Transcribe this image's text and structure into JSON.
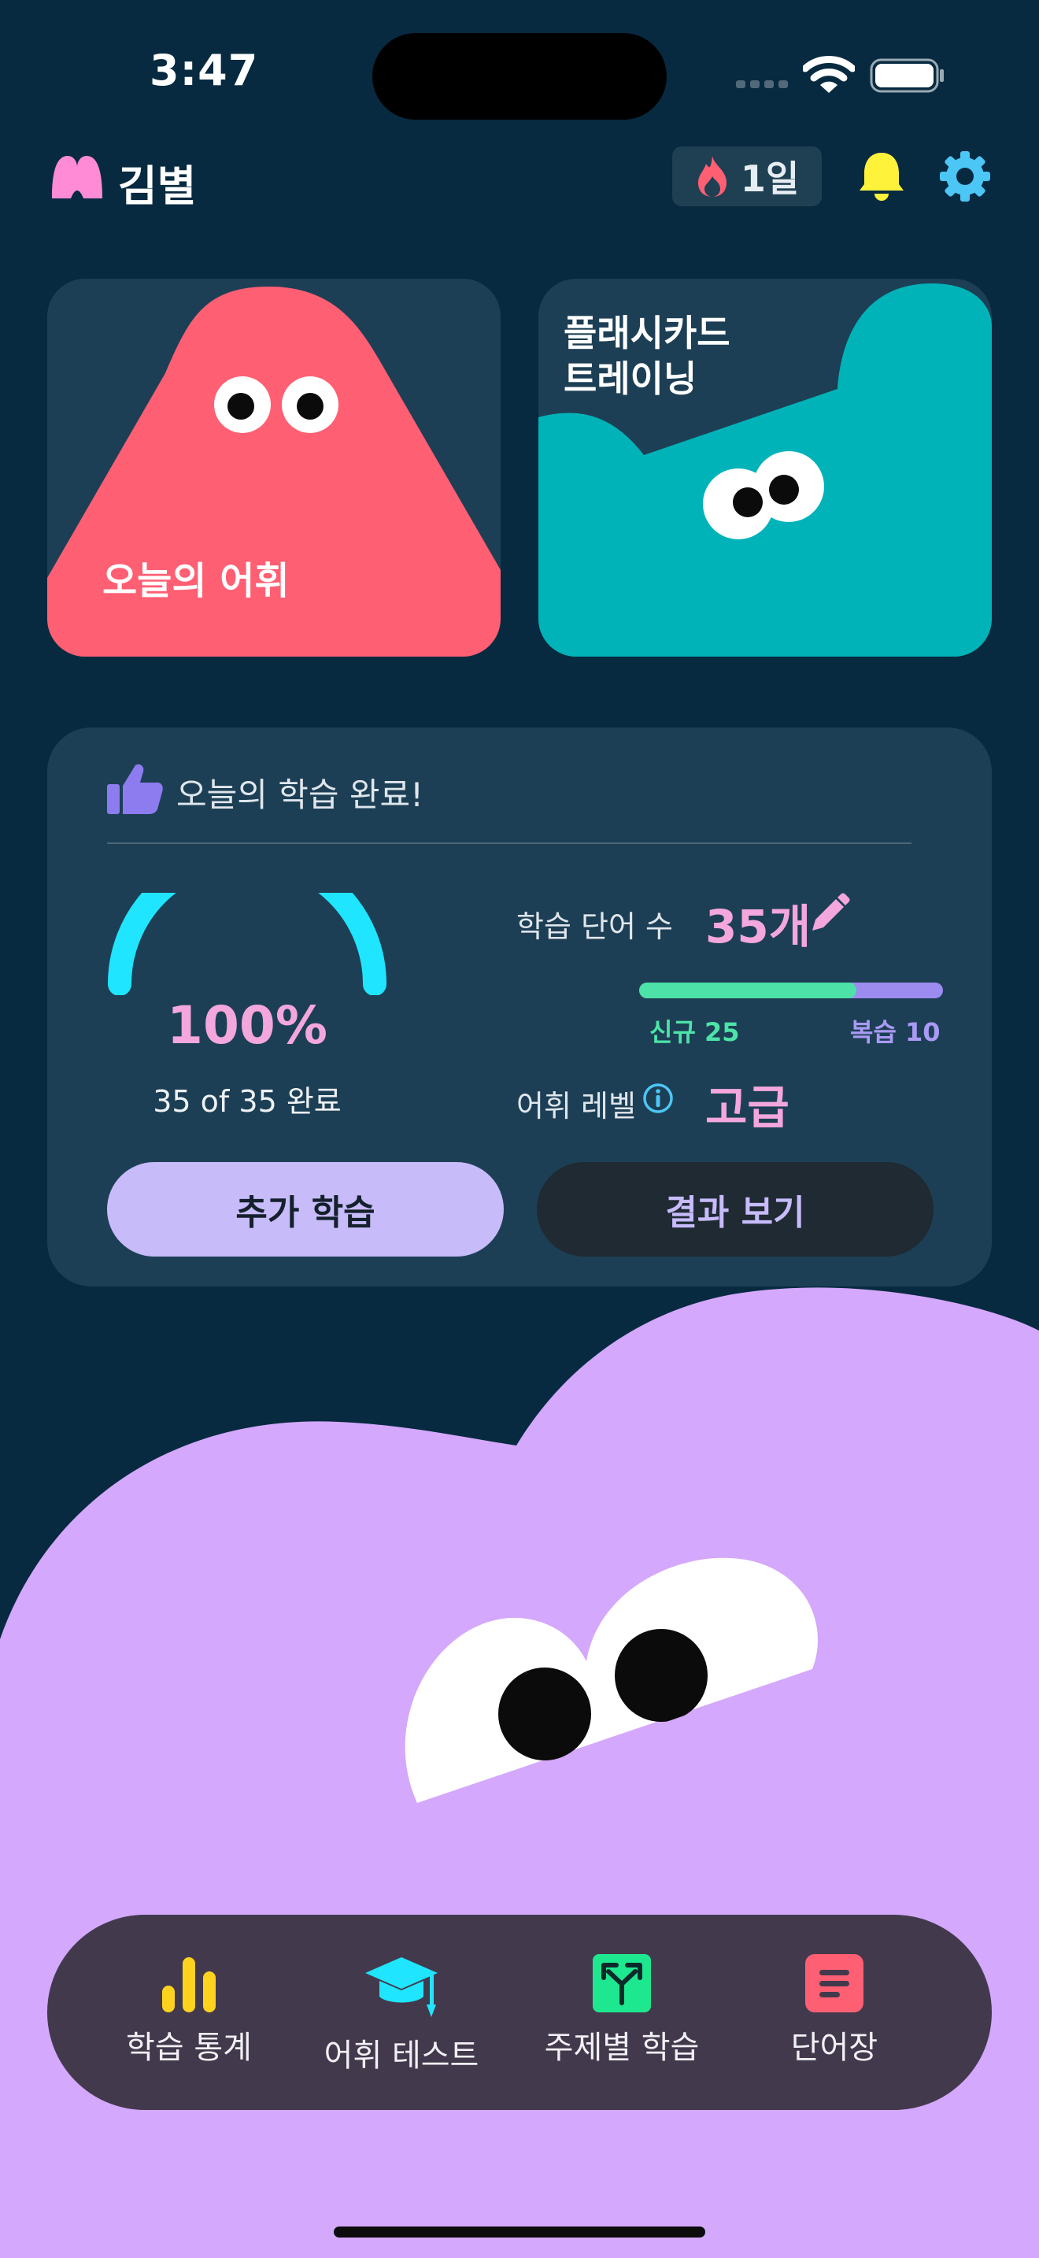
{
  "status_bar": {
    "time": "3:47",
    "icons": [
      "signal-icon",
      "wifi-icon",
      "battery-icon"
    ]
  },
  "header": {
    "logo_icon": "monster-logo-icon",
    "user_name": "김별",
    "streak": "1일",
    "streak_icon": "fire-icon",
    "actions": [
      "bell-icon",
      "gear-icon"
    ]
  },
  "cards": {
    "vocab": {
      "label": "오늘의 어휘",
      "color": "#ff5f73"
    },
    "flashcard": {
      "label_line1": "플래시카드",
      "label_line2": "트레이닝",
      "color": "#00b3b8"
    }
  },
  "progress": {
    "title": "오늘의 학습 완료!",
    "percent": "100%",
    "percent_value": 1.0,
    "sub": "35 of 35 완료",
    "words_label": "학습 단어 수",
    "words_count": "35개",
    "new_label": "신규 25",
    "review_label": "복습 10",
    "new_fraction": 0.714,
    "level_label": "어휘 레벨",
    "level_value": "고급",
    "button_more": "추가 학습",
    "button_result": "결과 보기"
  },
  "nav": {
    "items": [
      {
        "label": "학습 통계",
        "icon": "bar-chart-icon"
      },
      {
        "label": "어휘 테스트",
        "icon": "graduation-cap-icon"
      },
      {
        "label": "주제별 학습",
        "icon": "topic-branch-icon"
      },
      {
        "label": "단어장",
        "icon": "wordbook-icon"
      }
    ]
  },
  "colors": {
    "background": "#072a40",
    "card": "#1d3f55",
    "pink_accent": "#f3a7dd",
    "gauge": "#1fe5ff",
    "new": "#4de3a8",
    "review": "#9c8cf0",
    "blob": "#d4a8fc"
  }
}
